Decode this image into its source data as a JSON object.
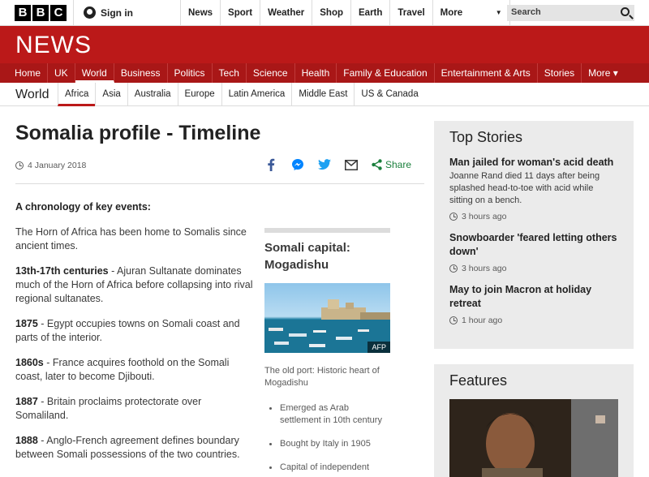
{
  "brand": {
    "logo_letters": [
      "B",
      "B",
      "C"
    ],
    "news_title": "NEWS"
  },
  "topbar": {
    "signin": "Sign in",
    "nav": [
      "News",
      "Sport",
      "Weather",
      "Shop",
      "Earth",
      "Travel"
    ],
    "more": "More",
    "search_placeholder": "Search"
  },
  "section_nav": {
    "items": [
      "Home",
      "UK",
      "World",
      "Business",
      "Politics",
      "Tech",
      "Science",
      "Health",
      "Family & Education",
      "Entertainment & Arts",
      "Stories",
      "More ▾"
    ],
    "active": "World"
  },
  "sub_nav": {
    "title": "World",
    "items": [
      "Africa",
      "Asia",
      "Australia",
      "Europe",
      "Latin America",
      "Middle East",
      "US & Canada"
    ],
    "active": "Africa"
  },
  "article": {
    "title": "Somalia profile - Timeline",
    "date": "4 January 2018",
    "share_label": "Share",
    "intro": "A chronology of key events:",
    "paragraphs": [
      {
        "lead": "",
        "text": "The Horn of Africa has been home to Somalis since ancient times."
      },
      {
        "lead": "13th-17th centuries",
        "text": " - Ajuran Sultanate dominates much of the Horn of Africa before collapsing into rival regional sultanates."
      },
      {
        "lead": "1875",
        "text": " - Egypt occupies towns on Somali coast and parts of the interior."
      },
      {
        "lead": "1860s",
        "text": " - France acquires foothold on the Somali coast, later to become Djibouti."
      },
      {
        "lead": "1887",
        "text": " - Britain proclaims protectorate over Somaliland."
      },
      {
        "lead": "1888",
        "text": " - Anglo-French agreement defines boundary between Somali possessions of the two countries."
      }
    ]
  },
  "factbox": {
    "title": "Somali capital: Mogadishu",
    "photo_credit": "AFP",
    "caption": "The old port: Historic heart of Mogadishu",
    "facts": [
      "Emerged as Arab settlement in 10th century",
      "Bought by Italy in 1905",
      "Capital of independent"
    ]
  },
  "top_stories": {
    "heading": "Top Stories",
    "stories": [
      {
        "headline": "Man jailed for woman's acid death",
        "summary": "Joanne Rand died 11 days after being splashed head-to-toe with acid while sitting on a bench.",
        "time": "3 hours ago"
      },
      {
        "headline": "Snowboarder 'feared letting others down'",
        "summary": "",
        "time": "3 hours ago"
      },
      {
        "headline": "May to join Macron at holiday retreat",
        "summary": "",
        "time": "1 hour ago"
      }
    ]
  },
  "features": {
    "heading": "Features"
  },
  "colors": {
    "brand_red": "#bb1919",
    "nav_red": "#a91717",
    "share_green": "#1a7f3c",
    "facebook": "#3b5998",
    "messenger": "#0084ff",
    "twitter": "#1da1f2"
  },
  "icons": [
    "user-icon",
    "chevron-down-icon",
    "search-icon",
    "clock-icon",
    "facebook-icon",
    "messenger-icon",
    "twitter-icon",
    "email-icon",
    "share-icon"
  ]
}
